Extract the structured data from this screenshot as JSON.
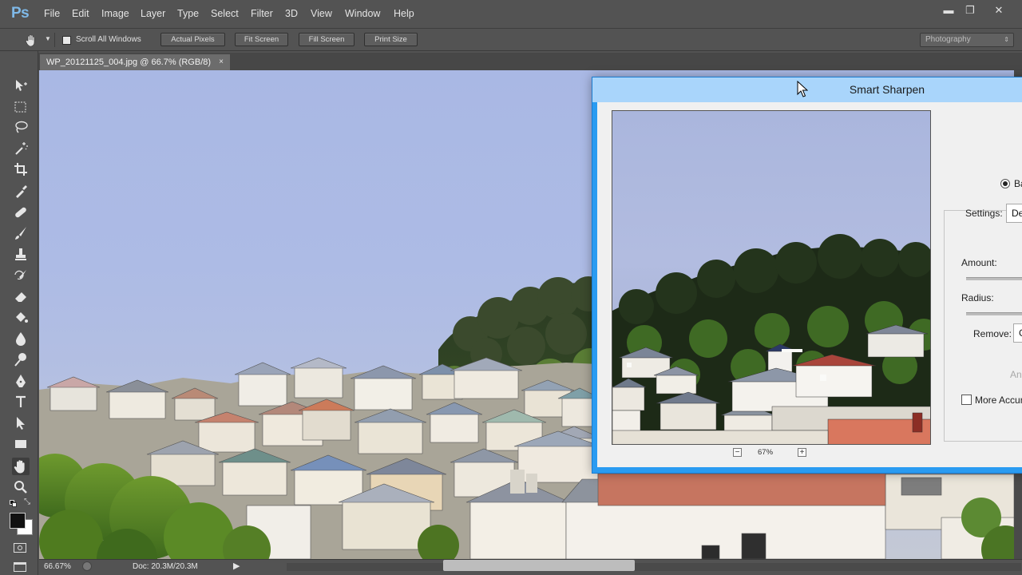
{
  "app": {
    "logo": "Ps"
  },
  "menu": [
    "File",
    "Edit",
    "Image",
    "Layer",
    "Type",
    "Select",
    "Filter",
    "3D",
    "View",
    "Window",
    "Help"
  ],
  "window_controls": {
    "minimize": "▬",
    "maximize": "❐",
    "close": "✕"
  },
  "options_bar": {
    "scroll_all_windows": "Scroll All Windows",
    "actual_pixels": "Actual Pixels",
    "fit_screen": "Fit Screen",
    "fill_screen": "Fill Screen",
    "print_size": "Print Size",
    "workspace": "Photography"
  },
  "document_tab": {
    "title": "WP_20121125_004.jpg @ 66.7% (RGB/8)",
    "close": "×"
  },
  "status_bar": {
    "zoom": "66.67%",
    "doc_size": "Doc: 20.3M/20.3M"
  },
  "tools": [
    "move-icon",
    "marquee-icon",
    "lasso-icon",
    "magic-wand-icon",
    "crop-icon",
    "eyedropper-icon",
    "healing-brush-icon",
    "brush-icon",
    "clone-stamp-icon",
    "history-brush-icon",
    "eraser-icon",
    "paint-bucket-icon",
    "blur-icon",
    "dodge-icon",
    "pen-icon",
    "type-icon",
    "path-selection-icon",
    "rectangle-icon",
    "hand-icon",
    "zoom-icon"
  ],
  "dialog": {
    "title": "Smart Sharpen",
    "zoom": "67%",
    "zoom_out": "−",
    "zoom_in": "+",
    "basic_label": "Ba",
    "settings_label": "Settings:",
    "settings_value": "De",
    "amount_label": "Amount:",
    "radius_label": "Radius:",
    "remove_label": "Remove:",
    "remove_value": "G",
    "angle_label": "An",
    "more_accurate_label": "More Accur"
  }
}
